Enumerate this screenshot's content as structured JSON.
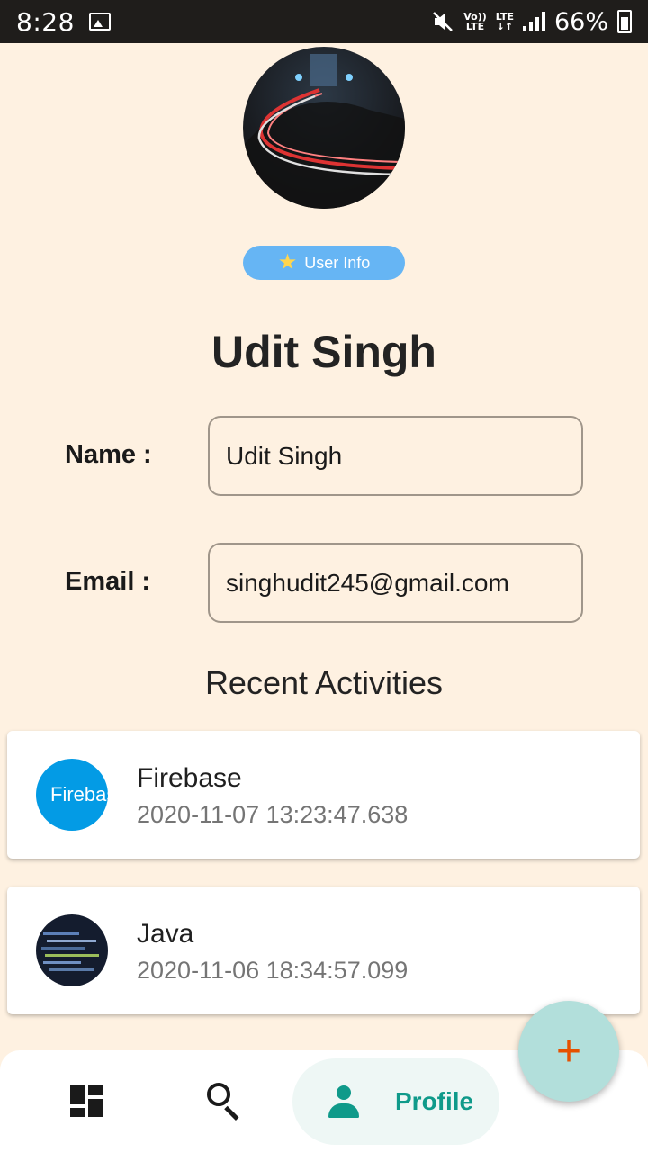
{
  "status_bar": {
    "time": "8:28",
    "volte_label": "Vo)) LTE",
    "lte_label": "LTE",
    "battery": "66%"
  },
  "profile": {
    "chip_label": "User Info",
    "display_name": "Udit Singh"
  },
  "form": {
    "name_label": "Name :",
    "name_value": "Udit Singh",
    "email_label": "Email :",
    "email_value": "singhudit245@gmail.com"
  },
  "activities": {
    "title": "Recent Activities",
    "items": [
      {
        "name": "Firebase",
        "timestamp": "2020-11-07 13:23:47.638",
        "thumb_text": "Firebas"
      },
      {
        "name": "Java",
        "timestamp": "2020-11-06 18:34:57.099"
      }
    ]
  },
  "nav": {
    "items": [
      {
        "icon": "dashboard-icon",
        "label": ""
      },
      {
        "icon": "search-icon",
        "label": ""
      },
      {
        "icon": "person-icon",
        "label": "Profile",
        "selected": true
      }
    ]
  },
  "fab": {
    "symbol": "+"
  },
  "colors": {
    "background": "#fef1e1",
    "chip": "#66b5f4",
    "accent": "#0f9a8a",
    "fab": "#b2dfdb",
    "fab_icon": "#e65100"
  }
}
